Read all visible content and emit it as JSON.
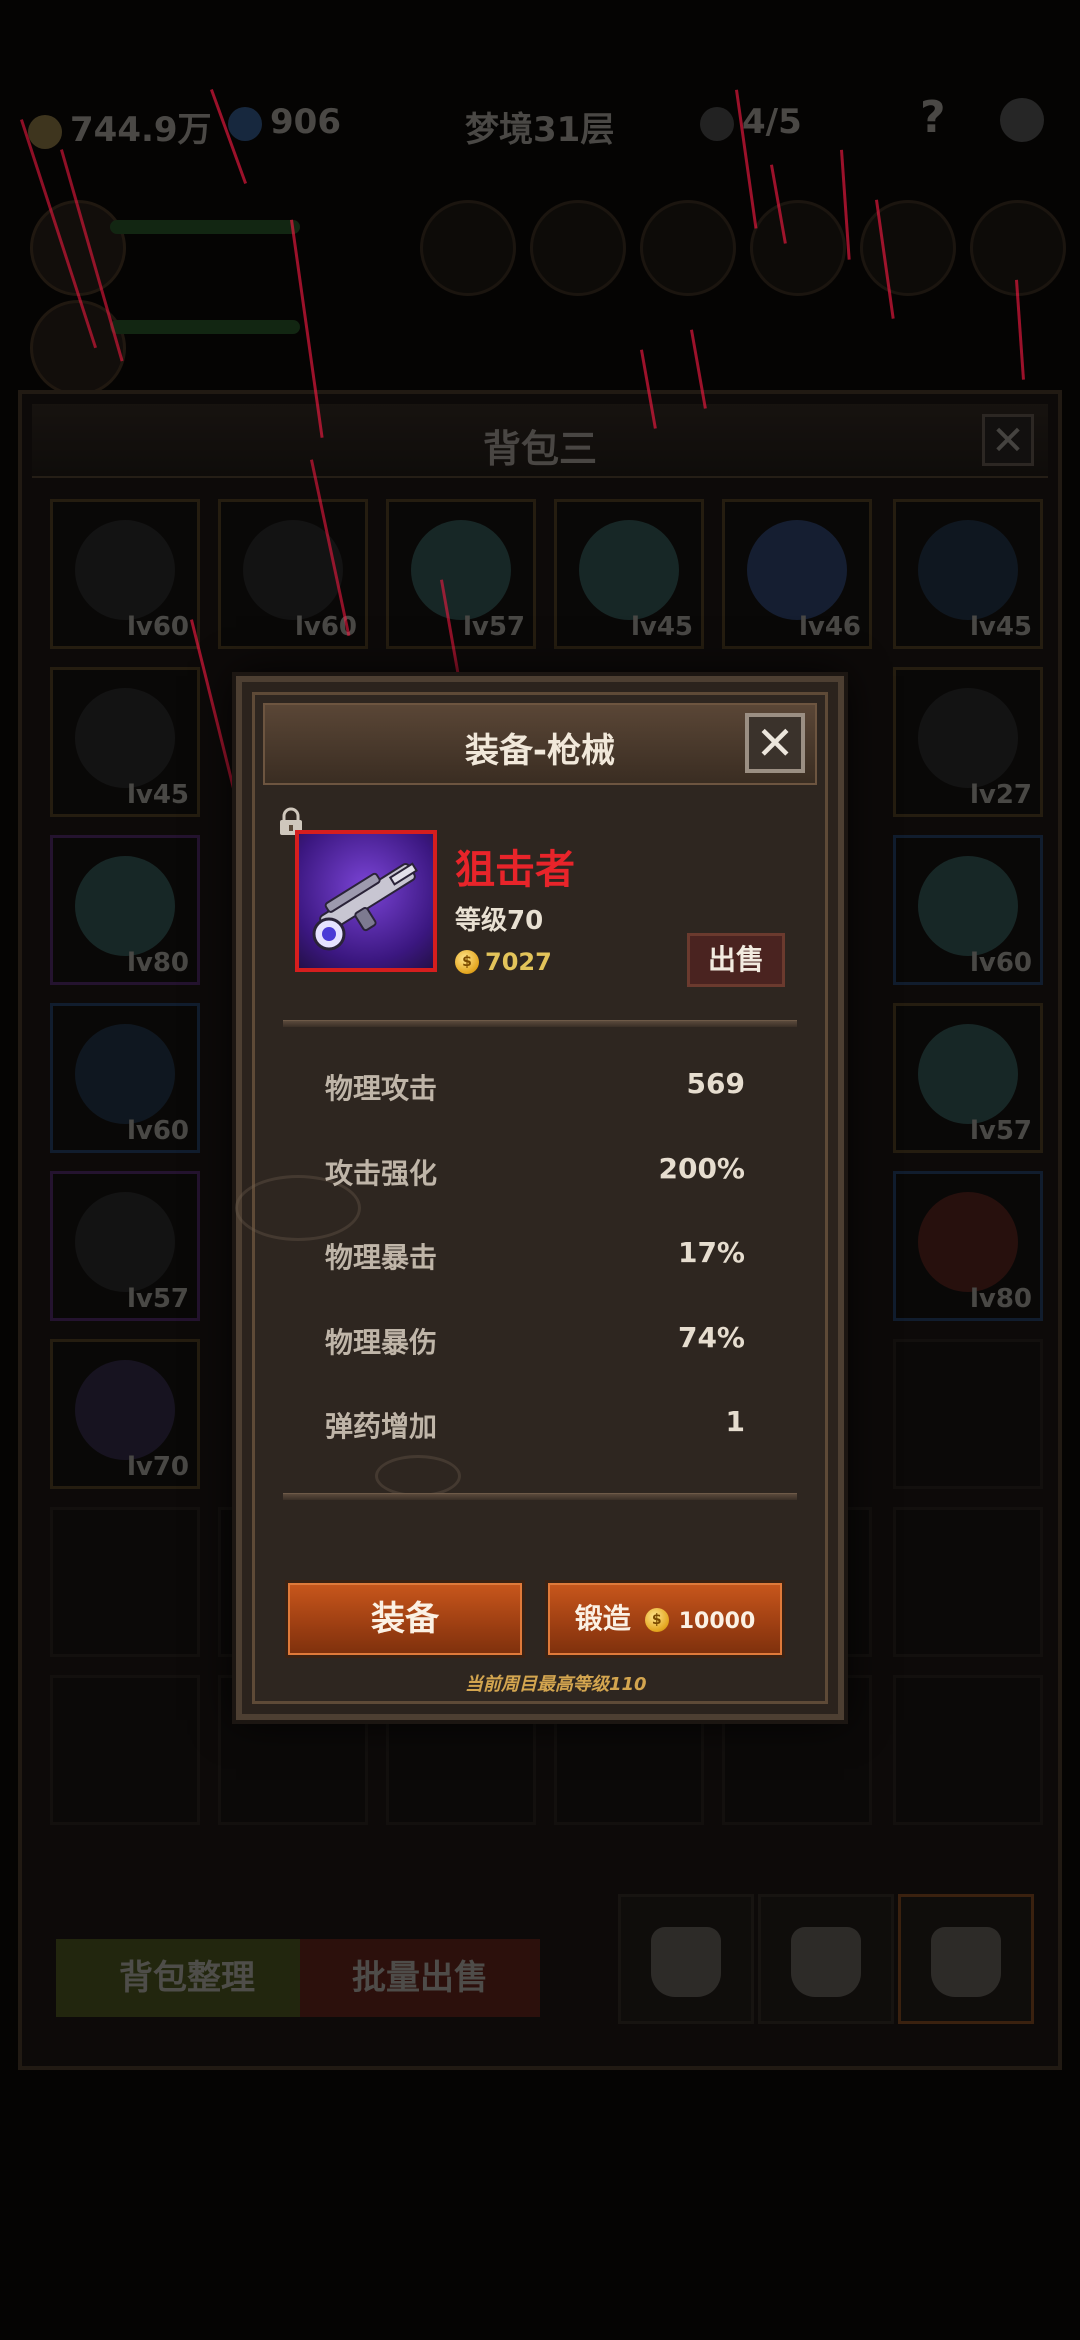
{
  "topbar": {
    "gold": "744.9万",
    "gems": "906",
    "floor": "梦境31层",
    "energy": "4/5",
    "help": "?"
  },
  "bag": {
    "title": "背包三",
    "close": "✕",
    "sort_label": "背包整理",
    "batch_sell_label": "批量出售",
    "slots": [
      {
        "lv": "lv60",
        "rarity": "gold",
        "icon": "ring-icon"
      },
      {
        "lv": "lv60",
        "rarity": "gold",
        "icon": "ring-icon"
      },
      {
        "lv": "lv57",
        "rarity": "gold",
        "icon": "orb-icon"
      },
      {
        "lv": "lv45",
        "rarity": "gold",
        "icon": "orb-icon"
      },
      {
        "lv": "lv46",
        "rarity": "gold",
        "icon": "amulet-icon"
      },
      {
        "lv": "lv45",
        "rarity": "gold",
        "icon": "armor-icon"
      },
      {
        "lv": "lv45",
        "rarity": "gold",
        "icon": "helmet-icon"
      },
      {
        "lv": "lv27",
        "rarity": "gold",
        "icon": "helmet-icon"
      },
      {
        "lv": "lv80",
        "rarity": "purple",
        "icon": "orb-icon"
      },
      {
        "lv": "lv60",
        "rarity": "blue",
        "icon": "orb-icon"
      },
      {
        "lv": "lv60",
        "rarity": "blue",
        "icon": "armor-icon"
      },
      {
        "lv": "lv57",
        "rarity": "gold",
        "icon": "orb-icon"
      },
      {
        "lv": "lv57",
        "rarity": "purple",
        "icon": "ring-icon"
      },
      {
        "lv": "lv80",
        "rarity": "blue",
        "icon": "shield-icon"
      },
      {
        "lv": "lv70",
        "rarity": "gold",
        "icon": "gun-icon"
      }
    ]
  },
  "dialog": {
    "title": "装备-枪械",
    "close": "✕",
    "item_name": "狙击者",
    "item_level": "等级70",
    "price": "7027",
    "sell_label": "出售",
    "stats": [
      {
        "k": "物理攻击",
        "v": "569"
      },
      {
        "k": "攻击强化",
        "v": "200%"
      },
      {
        "k": "物理暴击",
        "v": "17%"
      },
      {
        "k": "物理暴伤",
        "v": "74%"
      },
      {
        "k": "弹药增加",
        "v": "1"
      }
    ],
    "equip_label": "装备",
    "forge_label": "锻造",
    "forge_cost": "10000",
    "max_level_note": "当前周目最高等级110",
    "coin_symbol": "$"
  },
  "colors": {
    "item_name": "#e8242a",
    "button_orange": "#c9571c",
    "frame_red": "#d61e1e",
    "note_gold": "#d3a54f"
  }
}
